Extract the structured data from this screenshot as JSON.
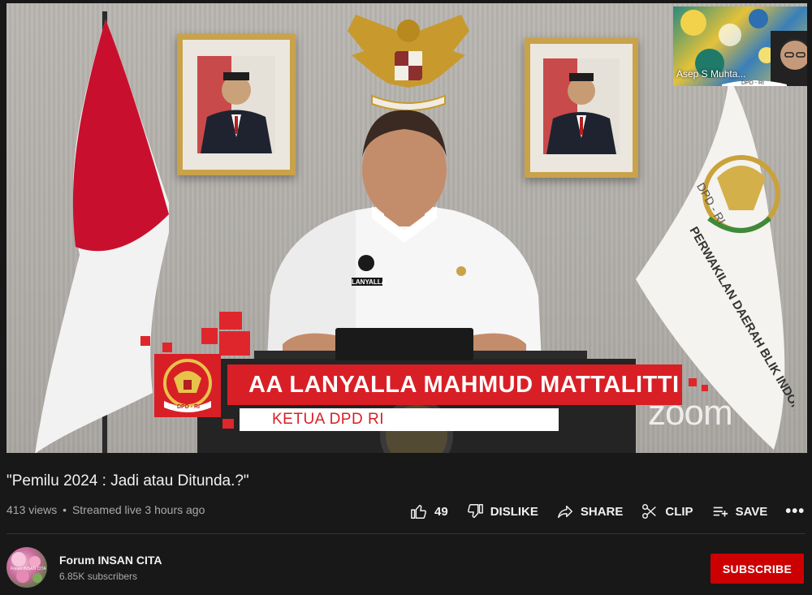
{
  "video": {
    "overlay_name": "AA LANYALLA MAHMUD MATTALITTI",
    "overlay_title": "KETUA DPD RI",
    "logo_text": "DPD - RI",
    "flag_text": "PERWAKILAN DAERAH BLIK INDONESIA",
    "flag_emblem_text": "DPD - RI",
    "watermark": "zoom",
    "participant_name": "Asep S Muhta...",
    "participant_badge": "DPD - RI",
    "shirt_text": "LANYALLA"
  },
  "info": {
    "title": "\"Pemilu 2024 : Jadi atau Ditunda.?\"",
    "views": "413 views",
    "separator": "•",
    "streamed": "Streamed live 3 hours ago"
  },
  "actions": {
    "like_count": "49",
    "dislike_label": "DISLIKE",
    "share_label": "SHARE",
    "clip_label": "CLIP",
    "save_label": "SAVE",
    "more_label": "•••"
  },
  "channel": {
    "name": "Forum INSAN CITA",
    "subscribers": "6.85K subscribers",
    "avatar_text": "Forum INSAN CITA",
    "subscribe_label": "SUBSCRIBE"
  },
  "colors": {
    "background": "#181818",
    "accent_red": "#d81f26",
    "subscribe_red": "#cc0000",
    "frame_gold": "#c9a24a"
  },
  "icons": [
    "thumbs-up-icon",
    "thumbs-down-icon",
    "share-icon",
    "scissors-icon",
    "playlist-add-icon",
    "more-icon"
  ]
}
